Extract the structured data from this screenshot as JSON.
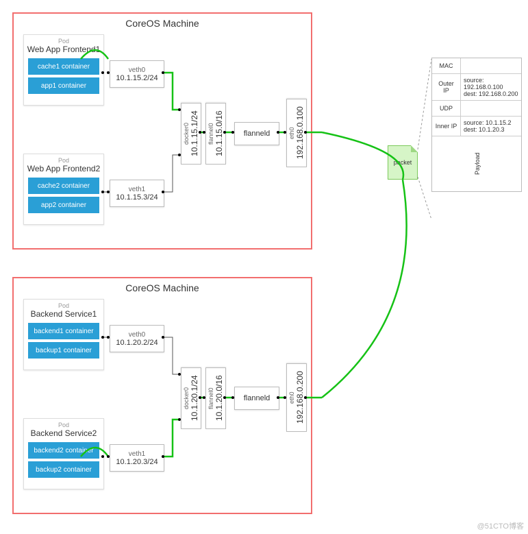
{
  "diagram_type": "network-topology",
  "watermark": "@51CTO博客",
  "machines": [
    {
      "title": "CoreOS Machine",
      "pods": [
        {
          "label": "Pod",
          "title": "Web App Frontend1",
          "containers": [
            "cache1 container",
            "app1 container"
          ]
        },
        {
          "label": "Pod",
          "title": "Web App Frontend2",
          "containers": [
            "cache2 container",
            "app2 container"
          ]
        }
      ],
      "veths": [
        {
          "name": "veth0",
          "ip": "10.1.15.2/24"
        },
        {
          "name": "veth1",
          "ip": "10.1.15.3/24"
        }
      ],
      "docker0": {
        "name": "docker0",
        "ip": "10.1.15.1/24"
      },
      "flannel0": {
        "name": "flannel0",
        "ip": "10.1.15.0/16"
      },
      "flanneld": "flanneld",
      "eth0": {
        "name": "eth0",
        "ip": "192.168.0.100"
      }
    },
    {
      "title": "CoreOS Machine",
      "pods": [
        {
          "label": "Pod",
          "title": "Backend Service1",
          "containers": [
            "backend1 container",
            "backup1 container"
          ]
        },
        {
          "label": "Pod",
          "title": "Backend Service2",
          "containers": [
            "backend2 container",
            "backup2 container"
          ]
        }
      ],
      "veths": [
        {
          "name": "veth0",
          "ip": "10.1.20.2/24"
        },
        {
          "name": "veth1",
          "ip": "10.1.20.3/24"
        }
      ],
      "docker0": {
        "name": "docker0",
        "ip": "10.1.20.1/24"
      },
      "flannel0": {
        "name": "flannel0",
        "ip": "10.1.20.0/16"
      },
      "flanneld": "flanneld",
      "eth0": {
        "name": "eth0",
        "ip": "192.168.0.200"
      }
    }
  ],
  "packet": {
    "label": "packet",
    "headers": [
      {
        "layer": "MAC",
        "info": ""
      },
      {
        "layer": "Outer IP",
        "info": "source: 192.168.0.100\ndest: 192.168.0.200"
      },
      {
        "layer": "UDP",
        "info": ""
      },
      {
        "layer": "Inner IP",
        "info": "source: 10.1.15.2\ndest: 10.1.20.3"
      },
      {
        "layer": "Payload",
        "info": ""
      }
    ]
  }
}
